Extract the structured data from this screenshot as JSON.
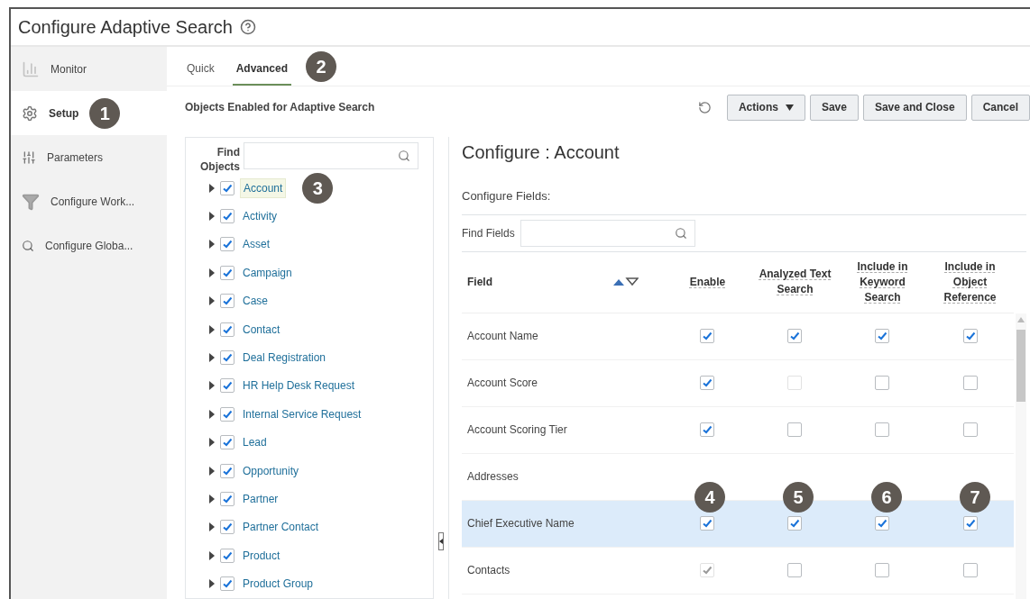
{
  "title": "Configure Adaptive Search",
  "sidebar": [
    {
      "label": "Monitor",
      "selected": false
    },
    {
      "label": "Setup",
      "selected": true,
      "callout": "1"
    },
    {
      "label": "Parameters",
      "selected": false
    },
    {
      "label": "Configure Work...",
      "selected": false
    },
    {
      "label": "Configure Globa...",
      "selected": false
    }
  ],
  "tabs": [
    {
      "label": "Quick",
      "selected": false
    },
    {
      "label": "Advanced",
      "selected": true
    }
  ],
  "tabs_callout": "2",
  "objects_heading": "Objects Enabled for Adaptive Search",
  "toolbar": [
    {
      "kind": "menu",
      "label": "Actions"
    },
    {
      "kind": "button",
      "label": "Save"
    },
    {
      "kind": "button",
      "label": "Save and Close"
    },
    {
      "kind": "button",
      "label": "Cancel"
    }
  ],
  "find_objects": {
    "label": "Find Objects"
  },
  "objects": [
    {
      "label": "Account",
      "checked": true,
      "selected": true,
      "callout": "3"
    },
    {
      "label": "Activity",
      "checked": true,
      "selected": false
    },
    {
      "label": "Asset",
      "checked": true,
      "selected": false
    },
    {
      "label": "Campaign",
      "checked": true,
      "selected": false
    },
    {
      "label": "Case",
      "checked": true,
      "selected": false
    },
    {
      "label": "Contact",
      "checked": true,
      "selected": false
    },
    {
      "label": "Deal Registration",
      "checked": true,
      "selected": false
    },
    {
      "label": "HR Help Desk Request",
      "checked": true,
      "selected": false
    },
    {
      "label": "Internal Service Request",
      "checked": true,
      "selected": false
    },
    {
      "label": "Lead",
      "checked": true,
      "selected": false
    },
    {
      "label": "Opportunity",
      "checked": true,
      "selected": false
    },
    {
      "label": "Partner",
      "checked": true,
      "selected": false
    },
    {
      "label": "Partner Contact",
      "checked": true,
      "selected": false
    },
    {
      "label": "Product",
      "checked": true,
      "selected": false
    },
    {
      "label": "Product Group",
      "checked": true,
      "selected": false
    }
  ],
  "configure_title": "Configure : Account",
  "configure_fields": "Configure Fields:",
  "find_fields": {
    "label": "Find Fields"
  },
  "columns": [
    {
      "label": "Field"
    },
    {
      "label": "Enable",
      "callout": "4"
    },
    {
      "label": "Analyzed Text Search",
      "callout": "5"
    },
    {
      "label": "Include in Keyword Search",
      "callout": "6"
    },
    {
      "label": "Include in Object Reference",
      "callout": "7"
    }
  ],
  "rows": [
    {
      "field": "Account Name",
      "selected": false,
      "cells": [
        {
          "checked": true,
          "disabled": false
        },
        {
          "checked": true,
          "disabled": false
        },
        {
          "checked": true,
          "disabled": false
        },
        {
          "checked": true,
          "disabled": false
        }
      ]
    },
    {
      "field": "Account Score",
      "selected": false,
      "cells": [
        {
          "checked": true,
          "disabled": false
        },
        {
          "checked": false,
          "disabled": true
        },
        {
          "checked": false,
          "disabled": false
        },
        {
          "checked": false,
          "disabled": false
        }
      ]
    },
    {
      "field": "Account Scoring Tier",
      "selected": false,
      "cells": [
        {
          "checked": true,
          "disabled": false
        },
        {
          "checked": false,
          "disabled": false
        },
        {
          "checked": false,
          "disabled": false
        },
        {
          "checked": false,
          "disabled": false
        }
      ]
    },
    {
      "field": "Addresses",
      "selected": false
    },
    {
      "field": "Chief Executive Name",
      "selected": true,
      "cells": [
        {
          "checked": true,
          "disabled": false
        },
        {
          "checked": true,
          "disabled": false
        },
        {
          "checked": true,
          "disabled": false
        },
        {
          "checked": true,
          "disabled": false
        }
      ]
    },
    {
      "field": "Contacts",
      "selected": false,
      "cells": [
        {
          "checked": true,
          "disabled": true
        },
        {
          "checked": false,
          "disabled": false
        },
        {
          "checked": false,
          "disabled": false
        },
        {
          "checked": false,
          "disabled": false
        }
      ]
    }
  ]
}
